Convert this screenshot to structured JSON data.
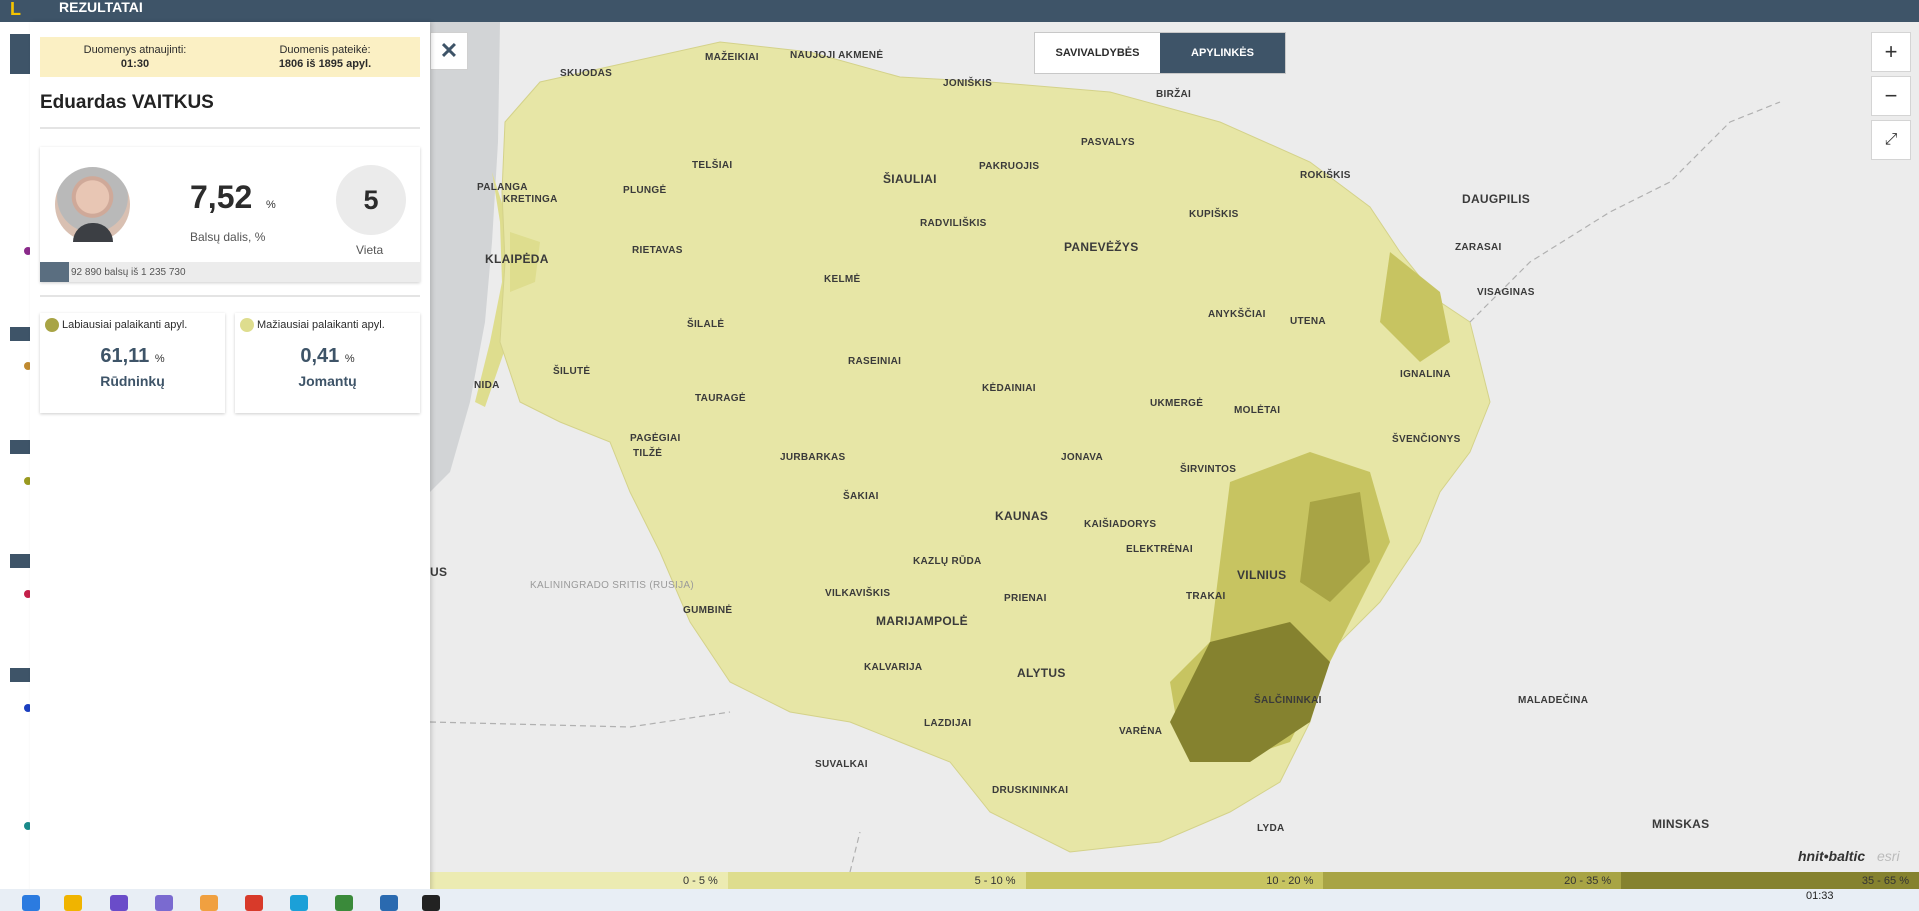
{
  "topbar": {
    "title": "REZULTATAI",
    "logo": "L"
  },
  "info": {
    "updated_label": "Duomenys atnaujinti:",
    "updated_value": "01:30",
    "reported_label": "Duomenis pateikė:",
    "reported_value": "1806 iš 1895 apyl."
  },
  "candidate": {
    "name": "Eduardas VAITKUS",
    "percent": "7,52",
    "percent_unit": "%",
    "percent_label": "Balsų dalis, %",
    "place": "5",
    "place_label": "Vieta",
    "votes_text": "92 890 balsų iš 1 235 730",
    "votes_fraction": 0.0752
  },
  "support": {
    "most": {
      "label": "Labiausiai palaikanti apyl.",
      "value": "61,11",
      "unit": "%",
      "place": "Rūdninkų"
    },
    "least": {
      "label": "Mažiausiai palaikanti apyl.",
      "value": "0,41",
      "unit": "%",
      "place": "Jomantų"
    }
  },
  "toggle": {
    "left": "SAVIVALDYBĖS",
    "right": "APYLINKĖS",
    "active": "right"
  },
  "map": {
    "cities": [
      "MAŽEIKIAI",
      "NAUJOJI AKMENĖ",
      "SKUODAS",
      "JONIŠKIS",
      "BIRŽAI",
      "PASVALYS",
      "TELŠIAI",
      "ŠIAULIAI",
      "PAKRUOJIS",
      "ROKIŠKIS",
      "PALANGA",
      "KRETINGA",
      "PLUNGĖ",
      "RADVILIŠKIS",
      "KUPIŠKIS",
      "KLAIPĖDA",
      "RIETAVAS",
      "PANEVĖŽYS",
      "ZARASAI",
      "VISAGINAS",
      "KELMĖ",
      "ANYKŠČIAI",
      "UTENA",
      "ŠILALĖ",
      "RASEINIAI",
      "ŠILUTĖ",
      "IGNALINA",
      "NIDA",
      "TAURAGĖ",
      "KĖDAINIAI",
      "UKMERGĖ",
      "MOLĖTAI",
      "PAGĖGIAI",
      "TILŽĖ",
      "JURBARKAS",
      "JONAVA",
      "ŠVENČIONYS",
      "ŠIRVINTOS",
      "ŠAKIAI",
      "KAUNAS",
      "KAIŠIADORYS",
      "ELEKTRĖNAI",
      "KAZLŲ RŪDA",
      "VILNIUS",
      "VILKAVIŠKIS",
      "TRAKAI",
      "PRIENAI",
      "GUMBINĖ",
      "MARIJAMPOLĖ",
      "KALVARIJA",
      "ALYTUS",
      "ŠALČININKAI",
      "VARĖNA",
      "LAZDIJAI",
      "SUVALKAI",
      "DRUSKININKAI",
      "LYDA",
      "DAUGPILIS",
      "MALADEČINA",
      "MINSKAS",
      "US"
    ],
    "kaliningrad": "KALININGRADO SRITIS (RUSIJA)",
    "attribution": "hnit•baltic",
    "attribution2": "esri"
  },
  "legend": {
    "ranges": [
      "0 - 5 %",
      "5 - 10 %",
      "10 - 20 %",
      "20 - 35 %",
      "35 - 65 %"
    ],
    "colors": [
      "#ecebb2",
      "#dedd8e",
      "#c7c461",
      "#a8a445",
      "#85822f"
    ]
  },
  "taskbar": {
    "clock": "01:33"
  },
  "icons": {
    "close": "✕",
    "zoom_in": "+",
    "zoom_out": "−",
    "fullscreen": "⤢"
  }
}
